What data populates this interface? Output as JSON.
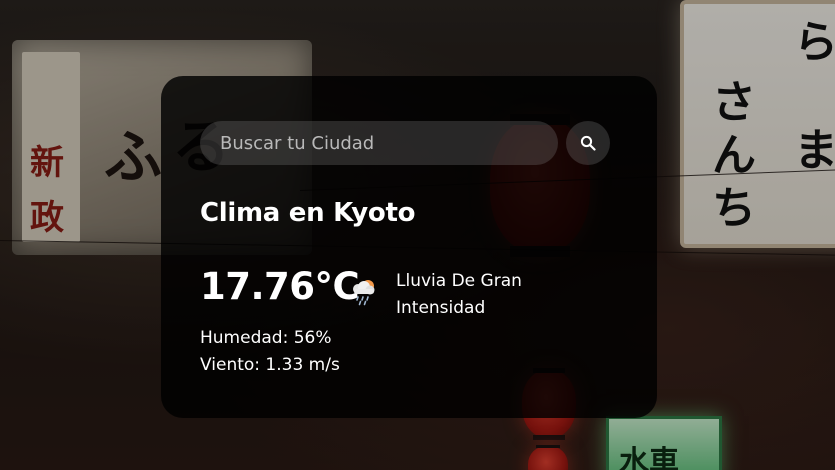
{
  "search": {
    "placeholder": "Buscar tu Ciudad",
    "value": "",
    "button_icon": "search-icon"
  },
  "weather": {
    "title": "Clima en Kyoto",
    "temperature": "17.76°C",
    "icon": "rain-cloud-icon",
    "description": "Lluvia De Gran Intensidad",
    "humidity": "Humedad: 56%",
    "wind": "Viento: 1.33 m/s"
  },
  "background": {
    "image": "kyoto-alley-photo",
    "sign_left_text": [
      "新",
      "政",
      "ふ",
      "る"
    ],
    "sign_right_text": [
      "ら",
      "さ",
      "ん",
      "ち",
      "ま"
    ],
    "green_sign_text": "水車"
  },
  "colors": {
    "card_background": "#000000",
    "text": "#ffffff",
    "input_background": "#7c7c7c",
    "placeholder": "#b9b9b9"
  }
}
